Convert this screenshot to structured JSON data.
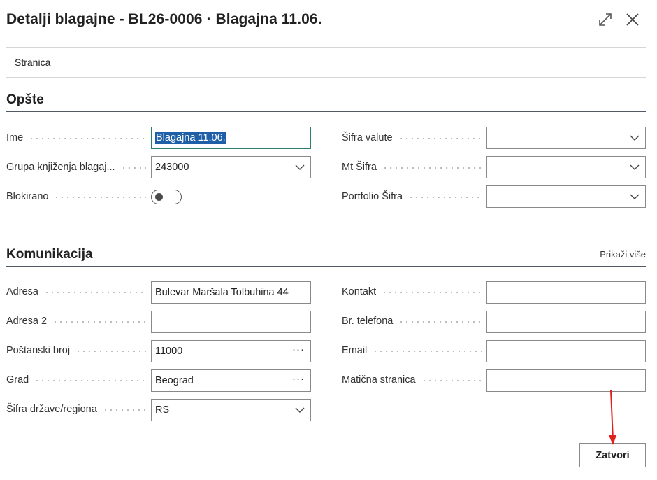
{
  "header": {
    "title": "Detalji blagajne - BL26-0006 · Blagajna 11.06."
  },
  "menu": {
    "items": [
      {
        "label": "Stranica"
      }
    ]
  },
  "general": {
    "title": "Opšte",
    "name": {
      "label": "Ime",
      "value": "Blagajna 11.06."
    },
    "posting_group": {
      "label": "Grupa knjiženja blagaj...",
      "value": "243000"
    },
    "blocked": {
      "label": "Blokirano",
      "value": false
    },
    "currency_code": {
      "label": "Šifra valute",
      "value": ""
    },
    "mt_code": {
      "label": "Mt Šifra",
      "value": ""
    },
    "portfolio_code": {
      "label": "Portfolio Šifra",
      "value": ""
    }
  },
  "communication": {
    "title": "Komunikacija",
    "show_more": "Prikaži više",
    "address": {
      "label": "Adresa",
      "value": "Bulevar Maršala Tolbuhina 44"
    },
    "address2": {
      "label": "Adresa 2",
      "value": ""
    },
    "post_code": {
      "label": "Poštanski broj",
      "value": "11000"
    },
    "city": {
      "label": "Grad",
      "value": "Beograd"
    },
    "country_region": {
      "label": "Šifra države/regiona",
      "value": "RS"
    },
    "contact": {
      "label": "Kontakt",
      "value": ""
    },
    "phone": {
      "label": "Br. telefona",
      "value": ""
    },
    "email": {
      "label": "Email",
      "value": ""
    },
    "home_page": {
      "label": "Matična stranica",
      "value": ""
    }
  },
  "footer": {
    "close_label": "Zatvori"
  },
  "colors": {
    "selection": "#1f5fa8",
    "focus_border": "#2f7d6f",
    "arrow": "#e0201c"
  }
}
